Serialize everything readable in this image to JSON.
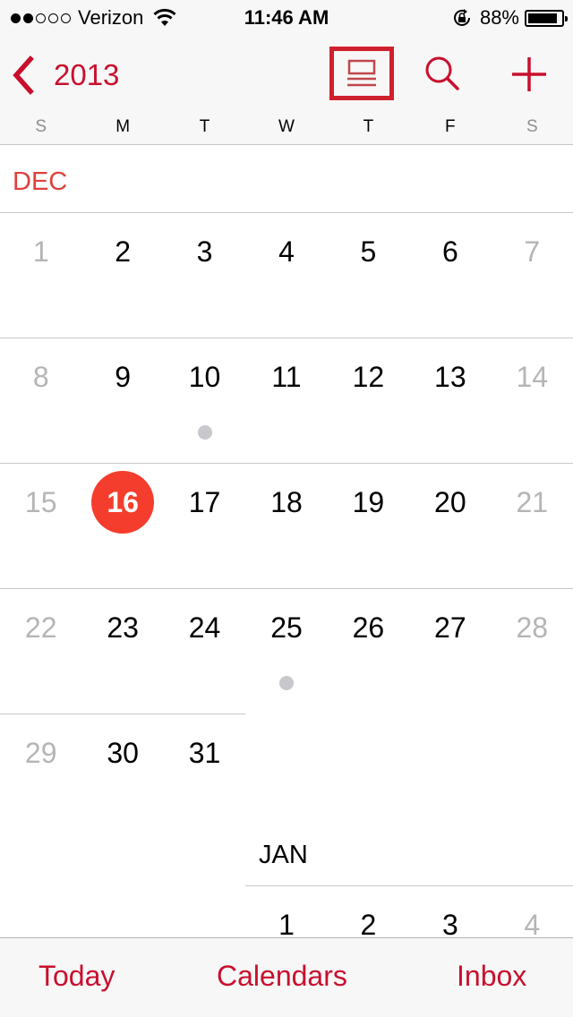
{
  "status_bar": {
    "signal_bars_filled": 2,
    "signal_bars_total": 5,
    "carrier": "Verizon",
    "wifi_icon": "wifi-icon",
    "time": "11:46 AM",
    "orientation_lock_icon": "rotation-lock-icon",
    "battery_percent": "88%",
    "battery_level": 0.88
  },
  "nav_bar": {
    "back_label": "2013",
    "back_icon": "chevron-left-icon",
    "list_toggle_icon": "list-view-icon",
    "search_icon": "search-icon",
    "add_icon": "plus-icon",
    "weekdays": [
      "S",
      "M",
      "T",
      "W",
      "T",
      "F",
      "S"
    ]
  },
  "calendar": {
    "current_month": "DEC",
    "next_month": "JAN",
    "today": 16,
    "weeks": [
      [
        1,
        2,
        3,
        4,
        5,
        6,
        7
      ],
      [
        8,
        9,
        10,
        11,
        12,
        13,
        14
      ],
      [
        15,
        16,
        17,
        18,
        19,
        20,
        21
      ],
      [
        22,
        23,
        24,
        25,
        26,
        27,
        28
      ],
      [
        29,
        30,
        31
      ]
    ],
    "next_month_first_week": [
      1,
      2,
      3,
      4
    ],
    "next_month_first_weekday": 3,
    "event_days": [
      10,
      25
    ]
  },
  "tab_bar": {
    "today": "Today",
    "calendars": "Calendars",
    "inbox": "Inbox"
  },
  "colors": {
    "accent": "#c8102e",
    "today_circle": "#f53d2d",
    "month_label": "#e0403a",
    "weekend_text": "#b5b5b5",
    "event_dot": "#c7c7cc"
  }
}
